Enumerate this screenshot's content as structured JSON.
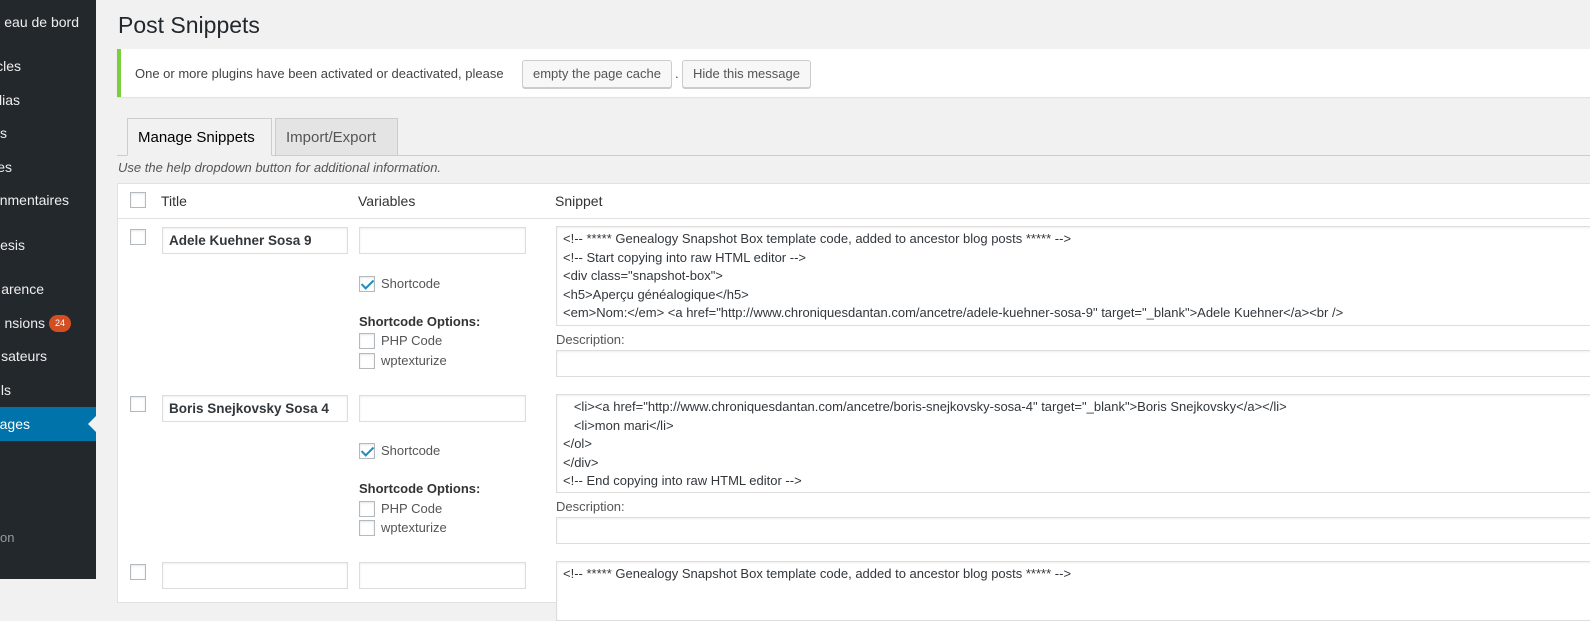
{
  "sidebar": {
    "items": [
      {
        "label": "eau de bord",
        "current": false
      },
      {
        "label": "cles",
        "current": false
      },
      {
        "label": "lias",
        "current": false
      },
      {
        "label": "s",
        "current": false
      },
      {
        "label": "es",
        "current": false
      },
      {
        "label": "nmentaires",
        "current": false
      },
      {
        "label": "esis",
        "current": false
      },
      {
        "label": "arence",
        "current": false
      },
      {
        "label": "nsions",
        "current": false,
        "badge": "24"
      },
      {
        "label": "sateurs",
        "current": false
      },
      {
        "label": "ls",
        "current": false
      },
      {
        "label": "ages",
        "current": true
      }
    ],
    "collapse_label": "on",
    "colors": {
      "bg": "#23282d",
      "current": "#0073aa",
      "badge": "#d54e21"
    }
  },
  "page_title": "Post Snippets",
  "notice": {
    "text": "One or more plugins have been activated or deactivated, please",
    "button_cache": "empty the page cache",
    "dot": ".",
    "button_hide": "Hide this message",
    "border_color": "#7ad03a"
  },
  "tabs": [
    {
      "label": "Manage Snippets",
      "active": true
    },
    {
      "label": "Import/Export",
      "active": false
    }
  ],
  "help_text": "Use the help dropdown button for additional information.",
  "table": {
    "headers": {
      "title": "Title",
      "variables": "Variables",
      "snippet": "Snippet"
    },
    "rows": [
      {
        "title": "Adele Kuehner Sosa 9",
        "variables": "",
        "shortcode_label": "Shortcode",
        "shortcode_checked": true,
        "options_heading": "Shortcode Options:",
        "php_label": "PHP Code",
        "wptexturize_label": "wptexturize",
        "snippet_lines": [
          "<!-- ***** Genealogy Snapshot Box template code, added to ancestor blog posts ***** -->",
          "<!-- Start copying into raw HTML editor -->",
          "<div class=\"snapshot-box\">",
          "<h5>Aperçu généalogique</h5>",
          "<em>Nom:</em> <a href=\"http://www.chroniquesdantan.com/ancetre/adele-kuehner-sosa-9\" target=\"_blank\">Adele Kuehner</a><br />"
        ],
        "description_label": "Description:",
        "description": ""
      },
      {
        "title": "Boris Snejkovsky Sosa 4",
        "variables": "",
        "shortcode_label": "Shortcode",
        "shortcode_checked": true,
        "options_heading": "Shortcode Options:",
        "php_label": "PHP Code",
        "wptexturize_label": "wptexturize",
        "snippet_lines": [
          "   <li><a href=\"http://www.chroniquesdantan.com/ancetre/boris-snejkovsky-sosa-4\" target=\"_blank\">Boris Snejkovsky</a></li>",
          "   <li>mon mari</li>",
          "</ol>",
          "</div>",
          "<!-- End copying into raw HTML editor -->"
        ],
        "description_label": "Description:",
        "description": ""
      },
      {
        "title": "",
        "variables": "",
        "snippet_lines": [
          "<!-- ***** Genealogy Snapshot Box template code, added to ancestor blog posts ***** -->"
        ]
      }
    ]
  }
}
